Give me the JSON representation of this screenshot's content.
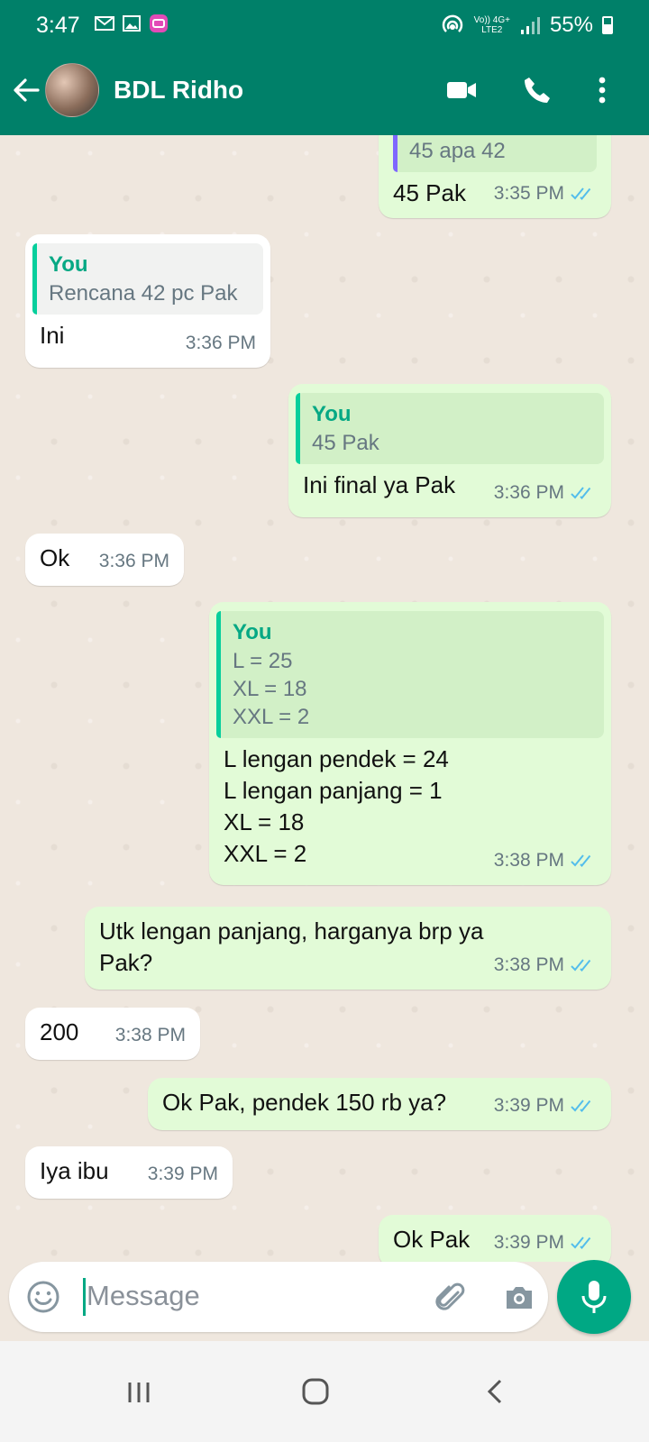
{
  "status_bar": {
    "time": "3:47",
    "network_top": "Vo)) 4G+",
    "network_bottom": "LTE2",
    "battery": "55%"
  },
  "header": {
    "contact_name": "BDL Ridho"
  },
  "messages": [
    {
      "dir": "out",
      "quote_text": "45 apa 42",
      "text": "45 Pak",
      "time": "3:35 PM"
    },
    {
      "dir": "in",
      "quote_author": "You",
      "quote_text": "Rencana 42 pc Pak",
      "text": "Ini",
      "time": "3:36 PM"
    },
    {
      "dir": "out",
      "quote_author": "You",
      "quote_text": "45 Pak",
      "text": "Ini final ya Pak",
      "time": "3:36 PM"
    },
    {
      "dir": "in",
      "text": "Ok",
      "time": "3:36 PM"
    },
    {
      "dir": "out",
      "quote_author": "You",
      "quote_lines": [
        "L = 25",
        "XL = 18",
        "XXL = 2"
      ],
      "lines": [
        "L lengan pendek = 24",
        "L lengan panjang = 1",
        "XL = 18",
        "XXL = 2"
      ],
      "time": "3:38 PM"
    },
    {
      "dir": "out",
      "lines": [
        "Utk lengan panjang, harganya brp ya",
        "Pak?"
      ],
      "time": "3:38 PM"
    },
    {
      "dir": "in",
      "text": "200",
      "time": "3:38 PM"
    },
    {
      "dir": "out",
      "text": "Ok Pak, pendek 150 rb ya?",
      "time": "3:39 PM"
    },
    {
      "dir": "in",
      "text": "Iya ibu",
      "time": "3:39 PM"
    },
    {
      "dir": "out",
      "text": "Ok Pak",
      "time": "3:39 PM"
    }
  ],
  "input": {
    "placeholder": "Message"
  },
  "colors": {
    "header": "#008069",
    "accent": "#00a884",
    "outgoing_bubble": "#e2fbd7",
    "incoming_bubble": "#ffffff",
    "read_ticks": "#53bdeb"
  },
  "icons": [
    "back-arrow-icon",
    "video-call-icon",
    "phone-icon",
    "more-vert-icon",
    "emoji-icon",
    "attach-icon",
    "camera-icon",
    "mic-icon",
    "recents-icon",
    "home-icon",
    "back-nav-icon"
  ]
}
